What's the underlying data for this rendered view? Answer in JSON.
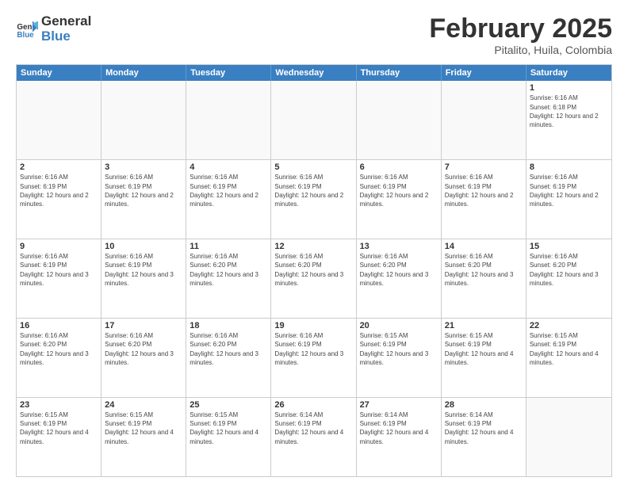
{
  "header": {
    "logo_general": "General",
    "logo_blue": "Blue",
    "month_title": "February 2025",
    "location": "Pitalito, Huila, Colombia"
  },
  "calendar": {
    "days_of_week": [
      "Sunday",
      "Monday",
      "Tuesday",
      "Wednesday",
      "Thursday",
      "Friday",
      "Saturday"
    ],
    "weeks": [
      [
        {
          "day": "",
          "info": ""
        },
        {
          "day": "",
          "info": ""
        },
        {
          "day": "",
          "info": ""
        },
        {
          "day": "",
          "info": ""
        },
        {
          "day": "",
          "info": ""
        },
        {
          "day": "",
          "info": ""
        },
        {
          "day": "1",
          "info": "Sunrise: 6:16 AM\nSunset: 6:18 PM\nDaylight: 12 hours and 2 minutes."
        }
      ],
      [
        {
          "day": "2",
          "info": "Sunrise: 6:16 AM\nSunset: 6:19 PM\nDaylight: 12 hours and 2 minutes."
        },
        {
          "day": "3",
          "info": "Sunrise: 6:16 AM\nSunset: 6:19 PM\nDaylight: 12 hours and 2 minutes."
        },
        {
          "day": "4",
          "info": "Sunrise: 6:16 AM\nSunset: 6:19 PM\nDaylight: 12 hours and 2 minutes."
        },
        {
          "day": "5",
          "info": "Sunrise: 6:16 AM\nSunset: 6:19 PM\nDaylight: 12 hours and 2 minutes."
        },
        {
          "day": "6",
          "info": "Sunrise: 6:16 AM\nSunset: 6:19 PM\nDaylight: 12 hours and 2 minutes."
        },
        {
          "day": "7",
          "info": "Sunrise: 6:16 AM\nSunset: 6:19 PM\nDaylight: 12 hours and 2 minutes."
        },
        {
          "day": "8",
          "info": "Sunrise: 6:16 AM\nSunset: 6:19 PM\nDaylight: 12 hours and 2 minutes."
        }
      ],
      [
        {
          "day": "9",
          "info": "Sunrise: 6:16 AM\nSunset: 6:19 PM\nDaylight: 12 hours and 3 minutes."
        },
        {
          "day": "10",
          "info": "Sunrise: 6:16 AM\nSunset: 6:19 PM\nDaylight: 12 hours and 3 minutes."
        },
        {
          "day": "11",
          "info": "Sunrise: 6:16 AM\nSunset: 6:20 PM\nDaylight: 12 hours and 3 minutes."
        },
        {
          "day": "12",
          "info": "Sunrise: 6:16 AM\nSunset: 6:20 PM\nDaylight: 12 hours and 3 minutes."
        },
        {
          "day": "13",
          "info": "Sunrise: 6:16 AM\nSunset: 6:20 PM\nDaylight: 12 hours and 3 minutes."
        },
        {
          "day": "14",
          "info": "Sunrise: 6:16 AM\nSunset: 6:20 PM\nDaylight: 12 hours and 3 minutes."
        },
        {
          "day": "15",
          "info": "Sunrise: 6:16 AM\nSunset: 6:20 PM\nDaylight: 12 hours and 3 minutes."
        }
      ],
      [
        {
          "day": "16",
          "info": "Sunrise: 6:16 AM\nSunset: 6:20 PM\nDaylight: 12 hours and 3 minutes."
        },
        {
          "day": "17",
          "info": "Sunrise: 6:16 AM\nSunset: 6:20 PM\nDaylight: 12 hours and 3 minutes."
        },
        {
          "day": "18",
          "info": "Sunrise: 6:16 AM\nSunset: 6:20 PM\nDaylight: 12 hours and 3 minutes."
        },
        {
          "day": "19",
          "info": "Sunrise: 6:16 AM\nSunset: 6:19 PM\nDaylight: 12 hours and 3 minutes."
        },
        {
          "day": "20",
          "info": "Sunrise: 6:15 AM\nSunset: 6:19 PM\nDaylight: 12 hours and 3 minutes."
        },
        {
          "day": "21",
          "info": "Sunrise: 6:15 AM\nSunset: 6:19 PM\nDaylight: 12 hours and 4 minutes."
        },
        {
          "day": "22",
          "info": "Sunrise: 6:15 AM\nSunset: 6:19 PM\nDaylight: 12 hours and 4 minutes."
        }
      ],
      [
        {
          "day": "23",
          "info": "Sunrise: 6:15 AM\nSunset: 6:19 PM\nDaylight: 12 hours and 4 minutes."
        },
        {
          "day": "24",
          "info": "Sunrise: 6:15 AM\nSunset: 6:19 PM\nDaylight: 12 hours and 4 minutes."
        },
        {
          "day": "25",
          "info": "Sunrise: 6:15 AM\nSunset: 6:19 PM\nDaylight: 12 hours and 4 minutes."
        },
        {
          "day": "26",
          "info": "Sunrise: 6:14 AM\nSunset: 6:19 PM\nDaylight: 12 hours and 4 minutes."
        },
        {
          "day": "27",
          "info": "Sunrise: 6:14 AM\nSunset: 6:19 PM\nDaylight: 12 hours and 4 minutes."
        },
        {
          "day": "28",
          "info": "Sunrise: 6:14 AM\nSunset: 6:19 PM\nDaylight: 12 hours and 4 minutes."
        },
        {
          "day": "",
          "info": ""
        }
      ]
    ]
  }
}
